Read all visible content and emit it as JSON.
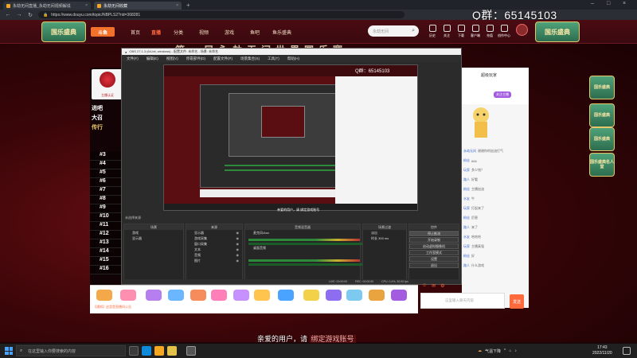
{
  "browser": {
    "tabs": [
      {
        "label": "永劫无间直播_永劫无间视频解说",
        "active": false
      },
      {
        "label": "永劫无间收藏",
        "active": true
      }
    ],
    "new_tab": "+",
    "url": "https://www.douyu.com/topic/NBPLS2?rid=368281",
    "qq_overlay": "Q群：65145103"
  },
  "douyu": {
    "left_badge": "国乐盛典",
    "right_badge": "国乐盛典",
    "logo": "斗鱼",
    "nav": [
      {
        "label": "首页",
        "active": false
      },
      {
        "label": "直播",
        "active": true
      },
      {
        "label": "分类",
        "active": false
      },
      {
        "label": "视频",
        "active": false
      },
      {
        "label": "游戏",
        "active": false
      },
      {
        "label": "鱼吧",
        "active": false
      },
      {
        "label": "鱼乐盛典",
        "active": false
      }
    ],
    "search_placeholder": "永劫无间",
    "top_icons": [
      "历史",
      "关注",
      "下载",
      "客户端",
      "充值",
      "创作中心"
    ],
    "banner": "第一届永劫无间世界国乐赛"
  },
  "rank": {
    "anchor_caption": "主播认证",
    "side_lines": [
      "进吧",
      "大召",
      "传行"
    ],
    "items": [
      "#3",
      "#4",
      "#5",
      "#6",
      "#7",
      "#8",
      "#9",
      "#10",
      "#11",
      "#12",
      "#13",
      "#14",
      "#15",
      "#16"
    ]
  },
  "obs": {
    "title": "OBS 27.1.3 (64-bit, windows) - 配置文件: 未命名 - 场景: 未命名",
    "menu": [
      "文件(F)",
      "编辑(E)",
      "视图(V)",
      "停靠部件(D)",
      "配置文件(P)",
      "场景集合(S)",
      "工具(T)",
      "帮助(H)"
    ],
    "preview_qq": "Q群：65145103",
    "preview_bottom_text": "亲爱的用户，请 绑定游戏账号",
    "panels": {
      "scenes_title": "场景",
      "scenes": [
        "游戏",
        "显示器"
      ],
      "sources_title": "来源",
      "sources": [
        "显示器",
        "游戏采集",
        "窗口采集",
        "文本",
        "音频",
        "图片"
      ],
      "mixer_title": "音频混音器",
      "mixer_tracks": [
        "麦克风/Aux",
        "桌面音频"
      ],
      "transitions_title": "场景过渡",
      "transition_value": "淡出",
      "duration_label": "时长",
      "duration_value": "300 ms",
      "controls_title": "控件",
      "controls": [
        "停止推流",
        "开始录制",
        "启动虚拟摄像机",
        "工作室模式",
        "设置",
        "退出"
      ]
    },
    "status": [
      "LIVE: 00:00:00",
      "REC: 00:00:00",
      "CPU: 0.4%, 30.00 fps"
    ],
    "scene_filter_label": "未选择来源"
  },
  "chat": {
    "header_user": "超级玩家",
    "header_tag": "关注主播",
    "messages": [
      {
        "user": "永劫无间",
        "text": "谢谢你的加油打气"
      },
      {
        "user": "粉丝",
        "text": "666"
      },
      {
        "user": "玩家",
        "text": "多少钱？"
      },
      {
        "user": "路人",
        "text": "好看"
      },
      {
        "user": "粉丝",
        "text": "主播加油"
      },
      {
        "user": "水友",
        "text": "牛"
      },
      {
        "user": "玩家",
        "text": "打起来了"
      },
      {
        "user": "粉丝",
        "text": "厉害"
      },
      {
        "user": "路人",
        "text": "来了"
      },
      {
        "user": "水友",
        "text": "哈哈哈"
      },
      {
        "user": "玩家",
        "text": "主播真强"
      },
      {
        "user": "粉丝",
        "text": "好"
      },
      {
        "user": "路人",
        "text": "什么游戏"
      }
    ],
    "input_placeholder": "这里输入聊天内容",
    "send": "发送"
  },
  "side_badges": [
    "国乐盛典",
    "国乐盛典",
    "国乐盛典",
    "国乐盛典名人堂"
  ],
  "giftbar": {
    "caption": "【通知】这里是直播间公告"
  },
  "subtitle": {
    "prefix": "亲爱的用户，请 ",
    "highlight": "绑定游戏账号"
  },
  "taskbar": {
    "search_placeholder": "在这里输入你要搜索的内容",
    "tray_text": "气温下降",
    "time": "17:43",
    "date": "2022/11/20"
  },
  "colors": {
    "accent": "#ff6a3d",
    "header_bg": "#4b0b12"
  }
}
